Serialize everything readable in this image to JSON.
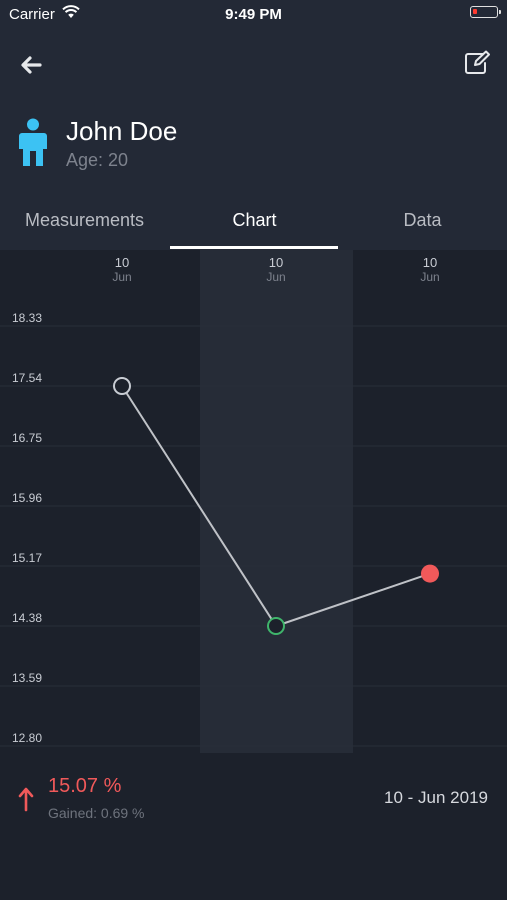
{
  "status_bar": {
    "carrier": "Carrier",
    "time": "9:49 PM",
    "battery_level": 0.1
  },
  "nav": {
    "back_icon": "arrow-left-icon",
    "edit_icon": "edit-icon"
  },
  "profile": {
    "name": "John Doe",
    "age": "Age: 20",
    "icon": "person-icon"
  },
  "tabs": [
    {
      "label": "Measurements",
      "active": false
    },
    {
      "label": "Chart",
      "active": true
    },
    {
      "label": "Data",
      "active": false
    }
  ],
  "colors": {
    "accent_red": "#f0595a",
    "accent_green": "#3fb56b",
    "person_blue": "#3cc2f3",
    "line": "#bfc2c7",
    "background": "#1c212b"
  },
  "chart_data": {
    "type": "line",
    "columns": [
      {
        "day": "10",
        "month": "Jun"
      },
      {
        "day": "10",
        "month": "Jun"
      },
      {
        "day": "10",
        "month": "Jun"
      }
    ],
    "y_ticks": [
      "18.33",
      "17.54",
      "16.75",
      "15.96",
      "15.17",
      "14.38",
      "13.59",
      "12.80"
    ],
    "ylim": [
      12.8,
      18.33
    ],
    "grid": true,
    "highlighted_column": 1,
    "points": [
      {
        "y": 17.54,
        "marker": "hollow-gray"
      },
      {
        "y": 14.38,
        "marker": "hollow-green"
      },
      {
        "y": 15.07,
        "marker": "filled-red"
      }
    ]
  },
  "footer": {
    "trend_icon": "arrow-up-icon",
    "percent": "15.07 %",
    "gained": "Gained: 0.69 %",
    "date": "10 - Jun 2019"
  }
}
